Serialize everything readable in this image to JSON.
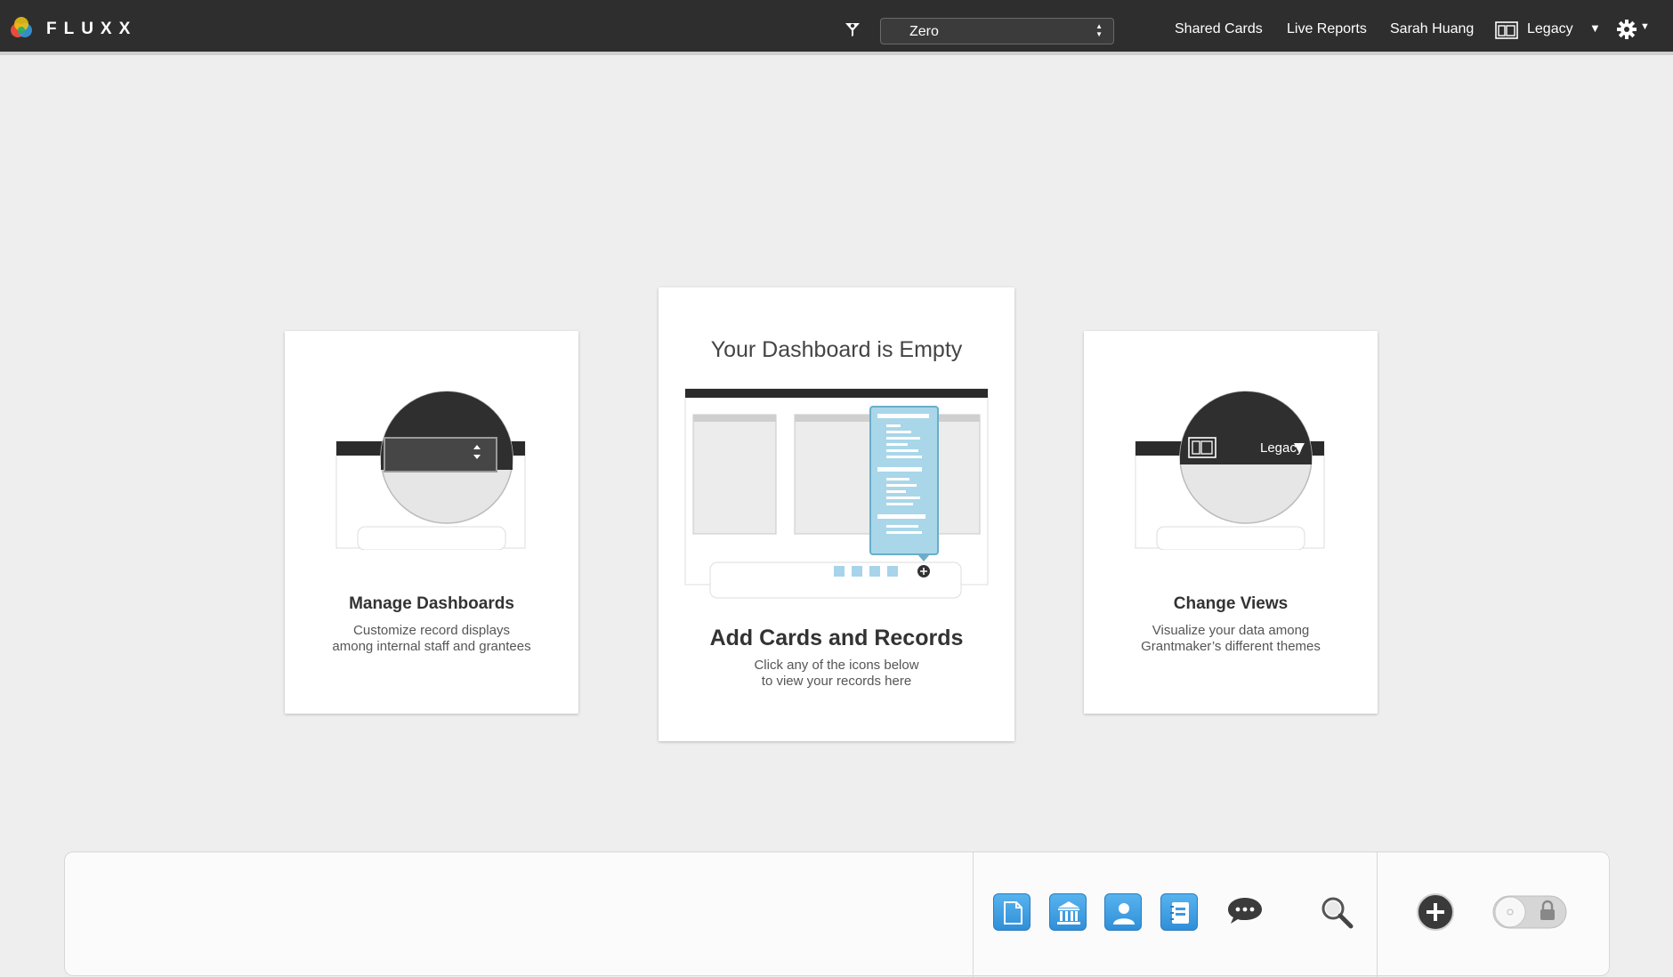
{
  "app": {
    "logo_text": "FLUXX"
  },
  "toolbar": {
    "dashboard_select_value": "Zero",
    "shared_cards": "Shared Cards",
    "live_reports": "Live Reports",
    "user_name": "Sarah Huang",
    "view_name": "Legacy",
    "icons": [
      "logo-icon",
      "filter-icon",
      "select-arrows-icon",
      "legacy-view-icon",
      "chevron-down-icon",
      "gear-icon"
    ]
  },
  "empty_state": {
    "heading": "Your Dashboard is Empty",
    "center": {
      "title": "Add Cards and Records",
      "desc_line1": "Click any of the icons below",
      "desc_line2": "to view your records here"
    },
    "left": {
      "title": "Manage Dashboards",
      "desc_line1": "Customize record displays",
      "desc_line2": "among internal staff and grantees"
    },
    "right": {
      "title": "Change Views",
      "desc_line1": "Visualize your data among",
      "desc_line2": "Grantmaker’s different themes",
      "illus_label": "Legacy"
    }
  },
  "dock": {
    "icons": [
      "document-icon",
      "institution-icon",
      "person-icon",
      "notebook-icon",
      "chat-icon",
      "search-icon",
      "add-icon",
      "lock-toggle"
    ],
    "colors": {
      "accent": "#3a9ae4",
      "topbar": "#2e2e2e",
      "background": "#eeeeee"
    }
  }
}
